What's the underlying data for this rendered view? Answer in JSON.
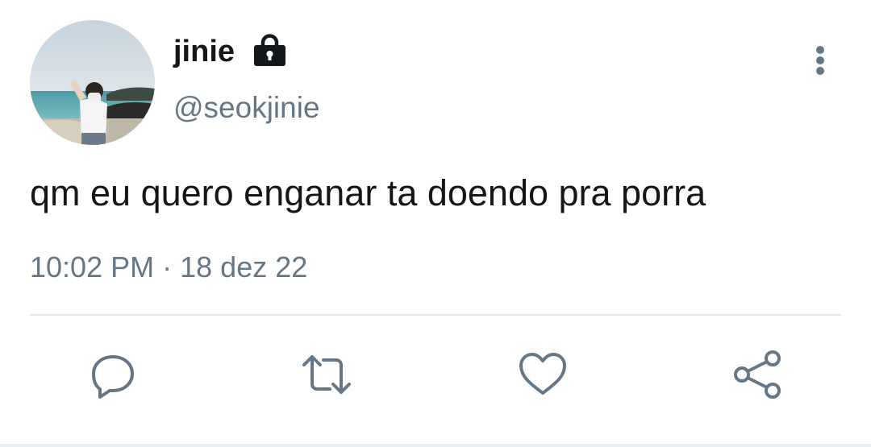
{
  "tweet": {
    "display_name": "jinie",
    "handle": "@seokjinie",
    "text": "qm eu quero enganar ta doendo pra porra",
    "time": "10:02 PM",
    "separator": "·",
    "date": "18 dez 22"
  },
  "icons": {
    "lock": "lock-icon",
    "more": "more-vertical-icon",
    "reply": "reply-icon",
    "retweet": "retweet-icon",
    "like": "heart-icon",
    "share": "share-icon"
  },
  "colors": {
    "text_primary": "#14171a",
    "text_secondary": "#657786",
    "divider": "#e1e8ed"
  }
}
